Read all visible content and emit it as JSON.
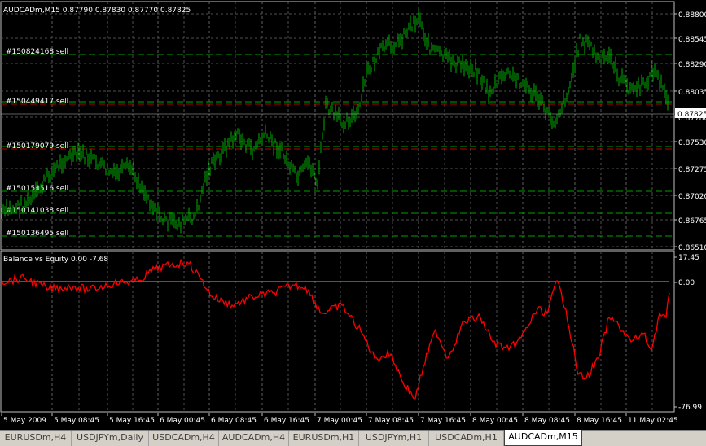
{
  "main_chart": {
    "header": "AUDCADm,M15  0.87790 0.87830 0.87770 0.87825",
    "price_levels": [
      "0.88800",
      "0.88545",
      "0.88290",
      "0.88035",
      "0.87780",
      "0.87530",
      "0.87275",
      "0.87020",
      "0.86765",
      "0.86510"
    ],
    "current_price": "0.87825",
    "orders": [
      "#150824168 sell",
      "#150449417 sell",
      "#150179079 sell",
      "#150154516 sell",
      "#150141038 sell",
      "#150136495 sell"
    ],
    "colors": {
      "candles": "#00b000",
      "grid": "#c0c0c0",
      "order_line": "#00c000",
      "order_line_red": "#c00000"
    }
  },
  "sub_chart": {
    "title": "Balance vs Equity 0.00 -7.68",
    "levels": [
      "17.45",
      "0.00",
      "-76.99"
    ],
    "colors": {
      "balance": "#00c000",
      "equity": "#ff0000"
    }
  },
  "time_axis": [
    "5 May 2009",
    "5 May 08:45",
    "5 May 16:45",
    "6 May 00:45",
    "6 May 08:45",
    "6 May 16:45",
    "7 May 00:45",
    "7 May 08:45",
    "7 May 16:45",
    "8 May 00:45",
    "8 May 08:45",
    "8 May 16:45",
    "11 May 02:45"
  ],
  "tabs": [
    "EURUSDm,H4",
    "USDJPYm,Daily",
    "USDCADm,H4",
    "AUDCADm,H4",
    "EURUSDm,H1",
    "USDJPYm,H1",
    "USDCADm,H1",
    "AUDCADm,M15"
  ],
  "active_tab": "AUDCADm,M15"
}
